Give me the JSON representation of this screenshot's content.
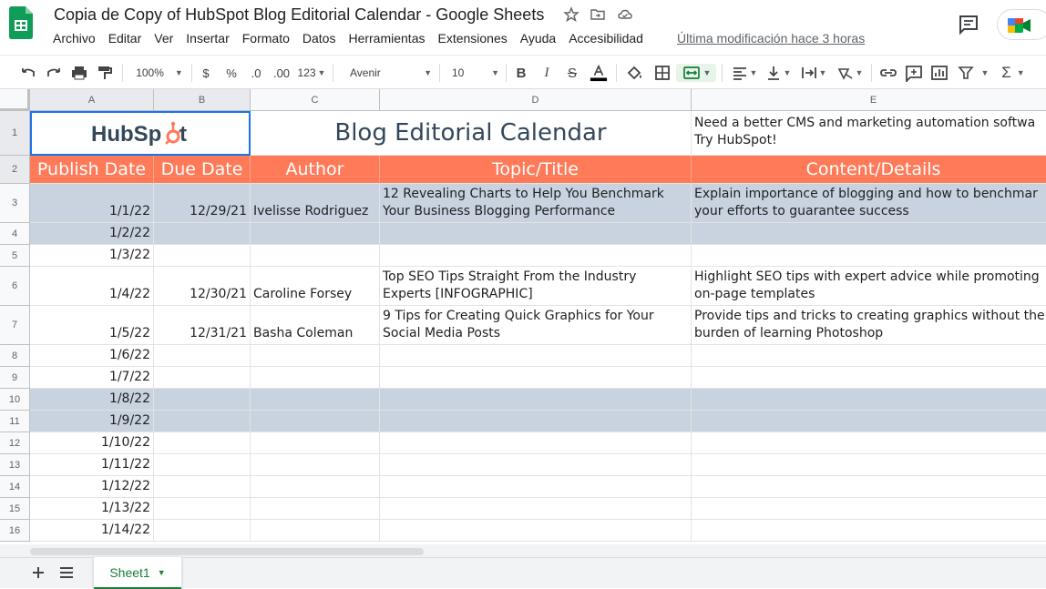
{
  "window": {
    "doc_title": "Copia de Copy of HubSpot Blog Editorial Calendar - Google Sheets",
    "last_modified": "Última modificación hace 3 horas"
  },
  "menu": [
    "Archivo",
    "Editar",
    "Ver",
    "Insertar",
    "Formato",
    "Datos",
    "Herramientas",
    "Extensiones",
    "Ayuda",
    "Accesibilidad"
  ],
  "toolbar": {
    "zoom": "100%",
    "currency": "$",
    "percent": "%",
    "dec_less": ".0",
    "dec_more": ".00",
    "more_formats": "123",
    "font": "Avenir",
    "font_size": "10"
  },
  "columns": [
    "A",
    "B",
    "C",
    "D",
    "E"
  ],
  "rows": [
    "1",
    "2",
    "3",
    "4",
    "5",
    "6",
    "7",
    "8",
    "9",
    "10",
    "11",
    "12",
    "13",
    "14",
    "15",
    "16"
  ],
  "sheet": {
    "logo_text": "HubSpot",
    "calendar_title": "Blog Editorial Calendar",
    "promo_line1": "Need a better CMS and marketing automation softwa",
    "promo_line2": "Try HubSpot!",
    "headers": [
      "Publish Date",
      "Due Date",
      "Author",
      "Topic/Title",
      "Content/Details"
    ],
    "data": [
      {
        "publish": "1/1/22",
        "due": "12/29/21",
        "author": "Ivelisse Rodriguez",
        "topic": "12 Revealing Charts to Help You Benchmark Your Business Blogging Performance",
        "details": "Explain importance of blogging and how to benchmar your efforts to guarantee success"
      },
      {
        "publish": "1/2/22",
        "due": "",
        "author": "",
        "topic": "",
        "details": ""
      },
      {
        "publish": "1/3/22",
        "due": "",
        "author": "",
        "topic": "",
        "details": ""
      },
      {
        "publish": "1/4/22",
        "due": "12/30/21",
        "author": "Caroline Forsey",
        "topic": "Top SEO Tips Straight From the Industry Experts [INFOGRAPHIC]",
        "details": "Highlight SEO tips with expert advice while promoting on-page templates"
      },
      {
        "publish": "1/5/22",
        "due": "12/31/21",
        "author": "Basha Coleman",
        "topic": "9 Tips for Creating Quick Graphics for Your Social Media Posts",
        "details": "Provide tips and tricks to creating graphics without the burden of learning Photoshop"
      },
      {
        "publish": "1/6/22",
        "due": "",
        "author": "",
        "topic": "",
        "details": ""
      },
      {
        "publish": "1/7/22",
        "due": "",
        "author": "",
        "topic": "",
        "details": ""
      },
      {
        "publish": "1/8/22",
        "due": "",
        "author": "",
        "topic": "",
        "details": ""
      },
      {
        "publish": "1/9/22",
        "due": "",
        "author": "",
        "topic": "",
        "details": ""
      },
      {
        "publish": "1/10/22",
        "due": "",
        "author": "",
        "topic": "",
        "details": ""
      },
      {
        "publish": "1/11/22",
        "due": "",
        "author": "",
        "topic": "",
        "details": ""
      },
      {
        "publish": "1/12/22",
        "due": "",
        "author": "",
        "topic": "",
        "details": ""
      },
      {
        "publish": "1/13/22",
        "due": "",
        "author": "",
        "topic": "",
        "details": ""
      },
      {
        "publish": "1/14/22",
        "due": "",
        "author": "",
        "topic": "",
        "details": ""
      }
    ]
  },
  "sheet_tab": "Sheet1",
  "colors": {
    "header_fill": "#ff7a59",
    "band_fill": "#c9d3df",
    "sheets_green": "#188038",
    "hubspot_navy": "#33475b",
    "hubspot_orange": "#ff7a59"
  }
}
